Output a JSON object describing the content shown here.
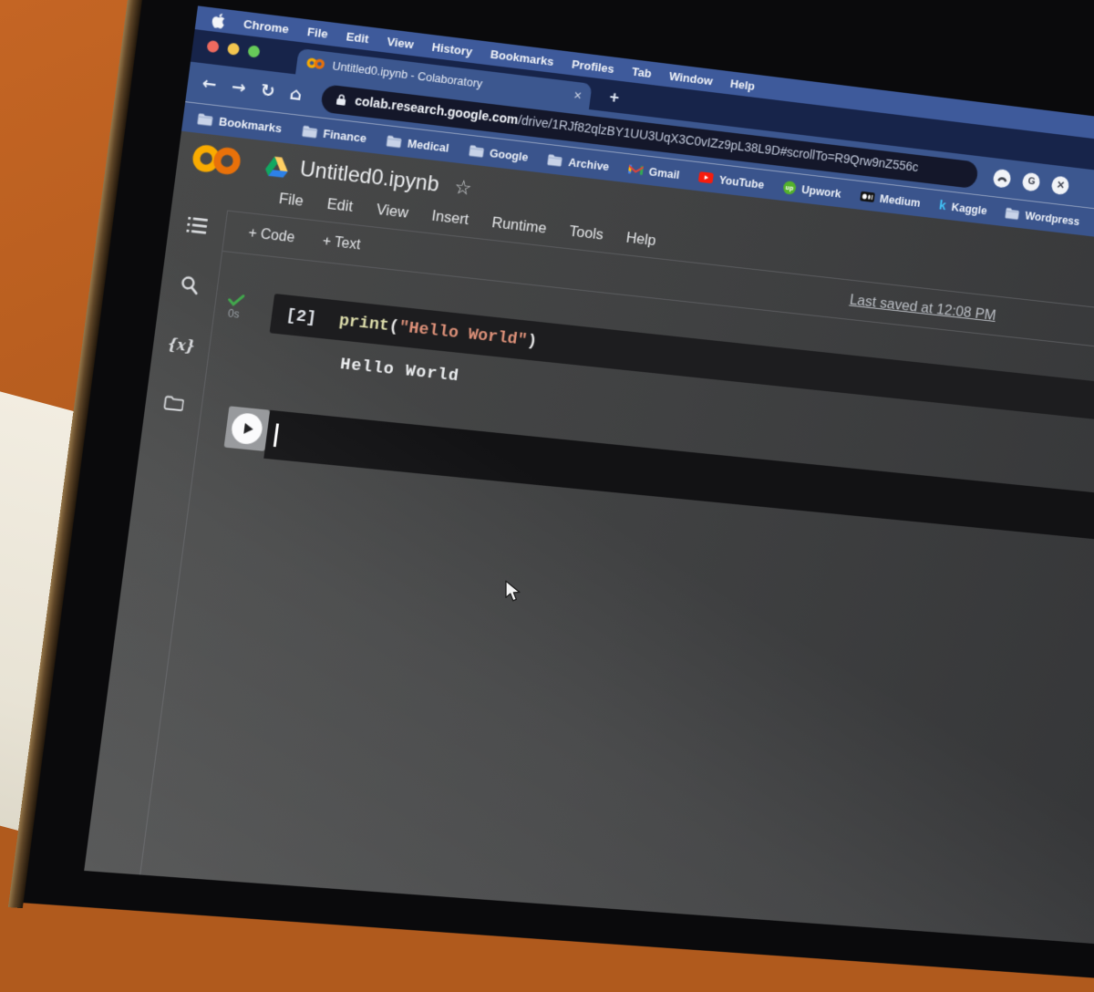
{
  "macos": {
    "menu_items": [
      "Chrome",
      "File",
      "Edit",
      "View",
      "History",
      "Bookmarks",
      "Profiles",
      "Tab",
      "Window",
      "Help"
    ]
  },
  "browser": {
    "tab_title": "Untitled0.ipynb - Colaboratory",
    "address": {
      "domain": "colab.research.google.com",
      "path": "/drive/1RJf82qlzBY1UU3UqX3C0vIZz9pL38L9D#scrollTo=R9Qrw9nZ556c"
    },
    "bookmarks": [
      "Bookmarks",
      "Finance",
      "Medical",
      "Google",
      "Archive",
      "Gmail",
      "YouTube",
      "Upwork",
      "Medium",
      "Kaggle",
      "Wordpress"
    ],
    "upwork_glyph": "up",
    "kaggle_glyph": "k",
    "google_ext_glyph": "G"
  },
  "colab": {
    "title": "Untitled0.ipynb",
    "menus": [
      "File",
      "Edit",
      "View",
      "Insert",
      "Runtime",
      "Tools",
      "Help"
    ],
    "toolbar": {
      "add_code": "+ Code",
      "add_text": "+ Text",
      "last_saved": "Last saved at 12:08 PM"
    },
    "cell": {
      "exec_count": "[2]",
      "exec_time": "0s",
      "code_fn": "print",
      "code_open": "(",
      "code_str": "\"Hello World\"",
      "code_close": ")",
      "output": "Hello World"
    }
  },
  "icons": {
    "back": "←",
    "forward": "→",
    "reload": "↻",
    "home": "⌂",
    "star": "☆",
    "close": "✕",
    "new_tab": "+",
    "variables": "{x}",
    "cross_ext": "✕"
  },
  "colors": {
    "wall_orange": "#b55c1e",
    "menubar_blue": "#3e5a9b",
    "tabstrip_navy": "#17244a",
    "toolbar_blue": "#3c578f",
    "urlbar_dark": "#14172a",
    "page_gray": "#404142",
    "cell_dark": "#1d1d1f",
    "traffic_red": "#ee6a5f",
    "traffic_yellow": "#f3c54f",
    "traffic_green": "#67cb59",
    "colab_ring_left": "#F9AB00",
    "colab_ring_right": "#E8710A",
    "success_green": "#41a84c",
    "code_function": "#dcdcaa",
    "code_string": "#de9179"
  }
}
